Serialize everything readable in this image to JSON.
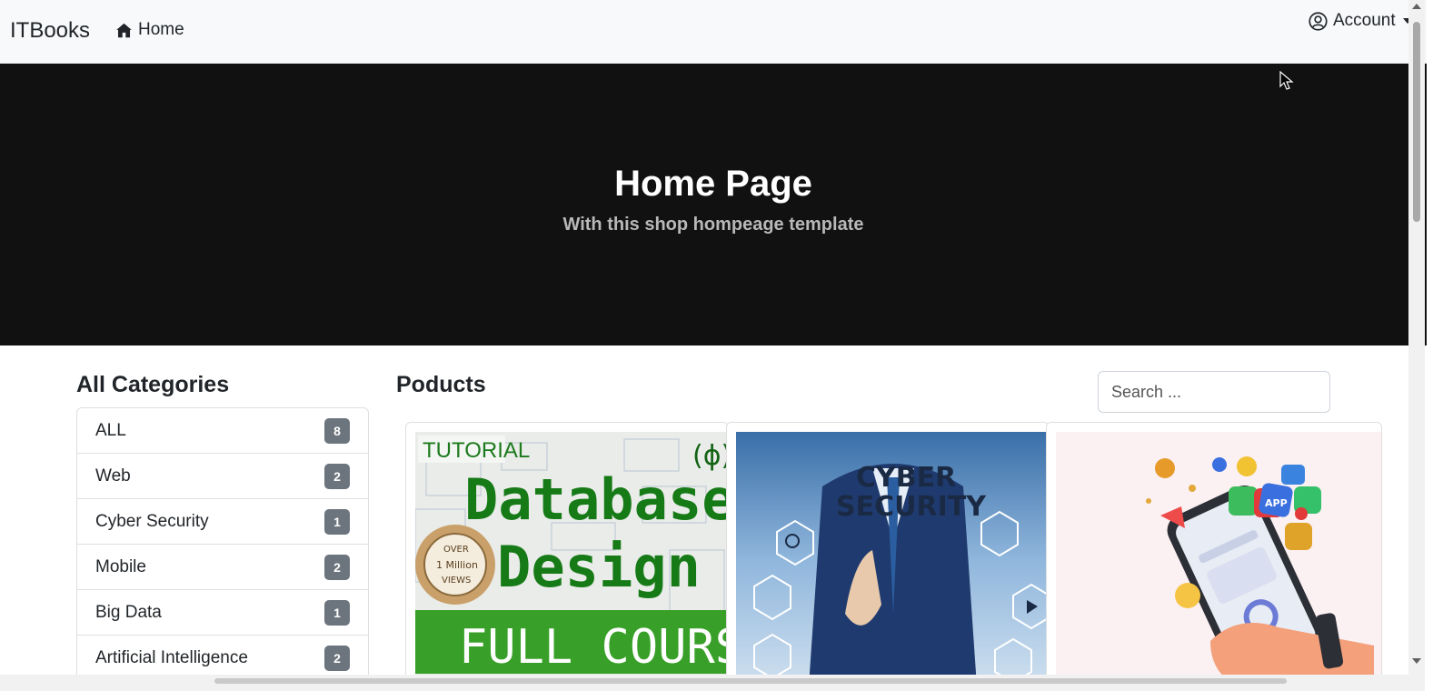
{
  "navbar": {
    "brand": "ITBooks",
    "home_label": "Home",
    "account_label": "Account"
  },
  "hero": {
    "title": "Home Page",
    "subtitle": "With this shop hompeage template"
  },
  "sidebar": {
    "title": "All Categories",
    "items": [
      {
        "label": "ALL",
        "count": "8"
      },
      {
        "label": "Web",
        "count": "2"
      },
      {
        "label": "Cyber Security",
        "count": "1"
      },
      {
        "label": "Mobile",
        "count": "2"
      },
      {
        "label": "Big Data",
        "count": "1"
      },
      {
        "label": "Artificial Intelligence",
        "count": "2"
      }
    ]
  },
  "products": {
    "title": "Poducts",
    "search_placeholder": "Search ...",
    "cards": [
      {
        "image_text": [
          "TUTORIAL",
          "Database",
          "Design",
          "OVER",
          "1 Million",
          "VIEWS",
          "FULL COURSE"
        ]
      },
      {
        "image_text": [
          "CYBER",
          "SECURITY"
        ]
      },
      {
        "image_text": [
          "APP"
        ]
      }
    ]
  },
  "colors": {
    "hero_bg": "#111111",
    "badge_bg": "#6c757d",
    "navbar_bg": "#f8f9fa"
  }
}
